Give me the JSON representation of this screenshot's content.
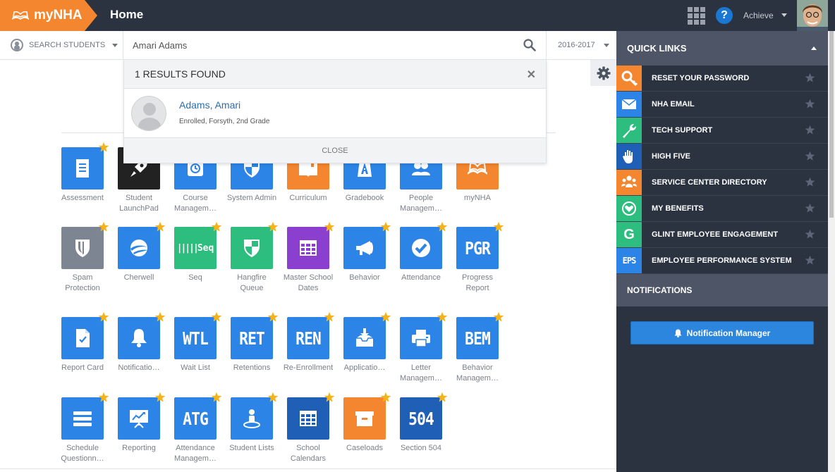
{
  "header": {
    "logo_text": "myNHA",
    "page_title": "Home",
    "help_label": "?",
    "user_menu": "Achieve"
  },
  "search": {
    "mode_label": "SEARCH STUDENTS",
    "query": "Amari Adams",
    "year": "2016-2017"
  },
  "results": {
    "count_label": "1 RESULTS FOUND",
    "close_x": "✕",
    "items": [
      {
        "name": "Adams, Amari",
        "detail": "Enrolled, Forsyth, 2nd Grade"
      }
    ],
    "close_label": "CLOSE"
  },
  "apps": [
    {
      "label": "Assessment",
      "icon": "document-icon",
      "color": "#2b84e6",
      "text": "",
      "favorite": true
    },
    {
      "label": "Student LaunchPad",
      "icon": "rocket-icon",
      "color": "#222222",
      "text": "",
      "favorite": false
    },
    {
      "label": "Course Managem…",
      "icon": "clock-icon",
      "color": "#2b84e6",
      "text": "",
      "favorite": false
    },
    {
      "label": "System Admin",
      "icon": "shield-icon",
      "color": "#2b84e6",
      "text": "",
      "favorite": false
    },
    {
      "label": "Curriculum",
      "icon": "book-icon",
      "color": "#f3862e",
      "text": "",
      "favorite": false
    },
    {
      "label": "Gradebook",
      "icon": "grade-icon",
      "color": "#2b84e6",
      "text": "",
      "favorite": false
    },
    {
      "label": "People Managem…",
      "icon": "people-icon",
      "color": "#2b84e6",
      "text": "",
      "favorite": false
    },
    {
      "label": "myNHA",
      "icon": "open-book-icon",
      "color": "#f3862e",
      "text": "",
      "favorite": false
    },
    {
      "label": "Spam Protection",
      "icon": "spam-shield-icon",
      "color": "#7d8593",
      "text": "",
      "favorite": true
    },
    {
      "label": "Cherwell",
      "icon": "cherwell-icon",
      "color": "#2b84e6",
      "text": "",
      "favorite": true
    },
    {
      "label": "Seq",
      "icon": "seq-icon",
      "color": "#2dbd7e",
      "text": "Seq",
      "favorite": true
    },
    {
      "label": "Hangfire Queue",
      "icon": "hangfire-shield-icon",
      "color": "#2dbd7e",
      "text": "",
      "favorite": true
    },
    {
      "label": "Master School Dates",
      "icon": "grid-calendar-icon",
      "color": "#8a3fcf",
      "text": "",
      "favorite": true
    },
    {
      "label": "Behavior",
      "icon": "megaphone-icon",
      "color": "#2b84e6",
      "text": "",
      "favorite": true
    },
    {
      "label": "Attendance",
      "icon": "checkmark-icon",
      "color": "#2b84e6",
      "text": "",
      "favorite": true
    },
    {
      "label": "Progress Report",
      "icon": "pgr-icon",
      "color": "#2b84e6",
      "text": "PGR",
      "favorite": true
    },
    {
      "label": "Report Card",
      "icon": "report-card-icon",
      "color": "#2b84e6",
      "text": "",
      "favorite": true
    },
    {
      "label": "Notificatio…",
      "icon": "bell-icon",
      "color": "#2b84e6",
      "text": "",
      "favorite": true
    },
    {
      "label": "Wait List",
      "icon": "wtl-icon",
      "color": "#2b84e6",
      "text": "WTL",
      "favorite": true
    },
    {
      "label": "Retentions",
      "icon": "ret-icon",
      "color": "#2b84e6",
      "text": "RET",
      "favorite": true
    },
    {
      "label": "Re-Enrollment",
      "icon": "ren-icon",
      "color": "#2b84e6",
      "text": "REN",
      "favorite": true
    },
    {
      "label": "Applicatio…",
      "icon": "inbox-download-icon",
      "color": "#2b84e6",
      "text": "",
      "favorite": true
    },
    {
      "label": "Letter Managem…",
      "icon": "printer-icon",
      "color": "#2b84e6",
      "text": "",
      "favorite": true
    },
    {
      "label": "Behavior Managem…",
      "icon": "bem-icon",
      "color": "#2b84e6",
      "text": "BEM",
      "favorite": true
    },
    {
      "label": "Schedule Questionn…",
      "icon": "server-list-icon",
      "color": "#2b84e6",
      "text": "",
      "favorite": true
    },
    {
      "label": "Reporting",
      "icon": "presentation-chart-icon",
      "color": "#2b84e6",
      "text": "",
      "favorite": true
    },
    {
      "label": "Attendance Managem…",
      "icon": "atg-icon",
      "color": "#2b84e6",
      "text": "ATG",
      "favorite": true
    },
    {
      "label": "Student Lists",
      "icon": "student-pin-icon",
      "color": "#2b84e6",
      "text": "",
      "favorite": true
    },
    {
      "label": "School Calendars",
      "icon": "calendar-grid-icon",
      "color": "#1f5fb5",
      "text": "",
      "favorite": true
    },
    {
      "label": "Caseloads",
      "icon": "archive-box-icon",
      "color": "#f3862e",
      "text": "",
      "favorite": true
    },
    {
      "label": "Section 504",
      "icon": "504-icon",
      "color": "#1f5fb5",
      "text": "504",
      "favorite": true
    }
  ],
  "quick_links": {
    "title": "QUICK LINKS",
    "items": [
      {
        "label": "RESET YOUR PASSWORD",
        "icon": "key-icon",
        "color": "#f3862e"
      },
      {
        "label": "NHA EMAIL",
        "icon": "envelope-icon",
        "color": "#2b84e6"
      },
      {
        "label": "TECH SUPPORT",
        "icon": "wrench-icon",
        "color": "#2dbd7e"
      },
      {
        "label": "HIGH FIVE",
        "icon": "hand-icon",
        "color": "#1f5fb5"
      },
      {
        "label": "SERVICE CENTER DIRECTORY",
        "icon": "group-icon",
        "color": "#f3862e"
      },
      {
        "label": "MY BENEFITS",
        "icon": "heart-icon",
        "color": "#2dbd7e"
      },
      {
        "label": "GLINT EMPLOYEE ENGAGEMENT",
        "icon": "glint-g-icon",
        "color": "#2dbd7e",
        "text": "G"
      },
      {
        "label": "EMPLOYEE PERFORMANCE SYSTEM",
        "icon": "eps-icon",
        "color": "#2b84e6",
        "text": "EPS"
      }
    ]
  },
  "notifications": {
    "title": "NOTIFICATIONS",
    "button_label": "Notification Manager"
  }
}
